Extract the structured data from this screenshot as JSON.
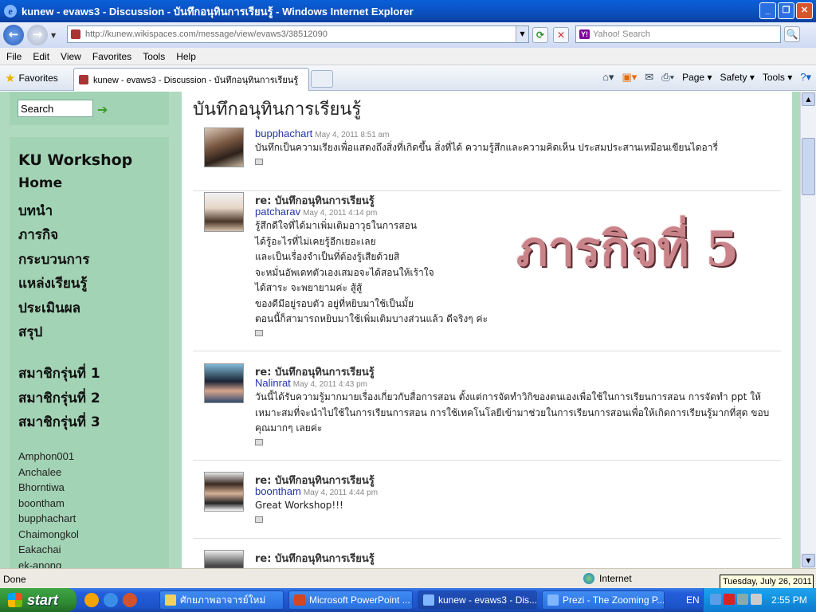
{
  "window": {
    "title": "kunew - evaws3 - Discussion - บันทึกอนุทินการเรียนรู้ - Windows Internet Explorer",
    "buttons": [
      "_",
      "❐",
      "✕"
    ]
  },
  "address": {
    "url": "http://kunew.wikispaces.com/message/view/evaws3/38512090",
    "search_placeholder": "Yahoo! Search",
    "yahoo_badge": "Y!"
  },
  "menu": [
    "File",
    "Edit",
    "View",
    "Favorites",
    "Tools",
    "Help"
  ],
  "favbar": {
    "favorites_label": "Favorites",
    "tab_title": "kunew - evaws3 - Discussion - บันทึกอนุทินการเรียนรู้",
    "page_label": "Page ▾",
    "safety_label": "Safety ▾",
    "tools_label": "Tools ▾"
  },
  "sidebar": {
    "search_value": "Search",
    "workspace_title": "KU Workshop",
    "nav": [
      "Home",
      "บทนำ",
      "ภารกิจ",
      "กระบวนการ",
      "แหล่งเรียนรู้",
      "ประเมินผล",
      "สรุป"
    ],
    "members": [
      "สมาชิกรุ่นที่ 1",
      "สมาชิกรุ่นที่ 2",
      "สมาชิกรุ่นที่ 3"
    ],
    "users": [
      "Amphon001",
      "Anchalee",
      "Bhorntiwa",
      "boontham",
      "bupphachart",
      "Chaimongkol",
      "Eakachai",
      "ek-anong"
    ]
  },
  "main": {
    "page_title": "บันทึกอนุทินการเรียนรู้",
    "overlay_text": "ภารกิจที่ 5",
    "posts": [
      {
        "reply": "",
        "author": "bupphachart",
        "date": "May 4, 2011 8:51 am",
        "lines": [
          "บันทึกเป็นความเรียงเพื่อแสดงถึงสิ่งที่เกิดขึ้น สิ่งที่ได้ ความรู้สึกและความคิดเห็น ประสมประสานเหมือนเขียนไดอารี่"
        ]
      },
      {
        "reply": "re: บันทึกอนุทินการเรียนรู้",
        "author": "patcharav",
        "date": "May 4, 2011 4:14 pm",
        "lines": [
          "รู้สึกดีใจที่ได้มาเพิ่มเติมอาวุธในการสอน",
          "ได้รู้อะไรที่ไม่เคยรู้อีกเยอะเลย",
          "และเป็นเรื่องจำเป็นที่ต้องรู้เสียด้วยสิ",
          "จะหมั่นอัพเดทตัวเองเสมอจะได้สอนให้เร้าใจ",
          "ได้สาระ จะพยายามค่ะ สู้สู้",
          "ของดีมีอยู่รอบตัว อยู่ที่หยิบมาใช้เป็นมั้ย",
          "ตอนนี้ก็สามารถหยิบมาใช้เพิ่มเติมบางส่วนแล้ว ดีจริงๆ ค่ะ"
        ]
      },
      {
        "reply": "re: บันทึกอนุทินการเรียนรู้",
        "author": "Nalinrat",
        "date": "May 4, 2011 4:43 pm",
        "lines": [
          "วันนี้ได้รับความรู้มากมายเรื่องเกี่ยวกับสื่อการสอน ตั้งแต่การจัดทำวิกิของตนเองเพื่อใช้ในการเรียนการสอน การจัดทำ ppt ให้",
          "เหมาะสมที่จะนำไปใช้ในการเรียนการสอน การใช้เทคโนโลยีเข้ามาช่วยในการเรียนการสอนเพื่อให้เกิดการเรียนรู้มากที่สุด ขอบ",
          "คุณมากๆ เลยค่ะ"
        ]
      },
      {
        "reply": "re: บันทึกอนุทินการเรียนรู้",
        "author": "boontham",
        "date": "May 4, 2011 4:44 pm",
        "lines": [
          "Great Workshop!!!"
        ]
      },
      {
        "reply": "re: บันทึกอนุทินการเรียนรู้",
        "author": "",
        "date": "",
        "lines": []
      }
    ]
  },
  "status": {
    "text": "Done",
    "zone": "Internet",
    "tooltip": "Tuesday, July 26, 2011"
  },
  "taskbar": {
    "start_label": "start",
    "buttons": [
      "ศักยภาพอาจารย์ใหม่",
      "Microsoft PowerPoint ...",
      "kunew - evaws3 - Dis...",
      "Prezi - The Zooming P..."
    ],
    "lang": "EN",
    "clock": "2:55 PM"
  }
}
